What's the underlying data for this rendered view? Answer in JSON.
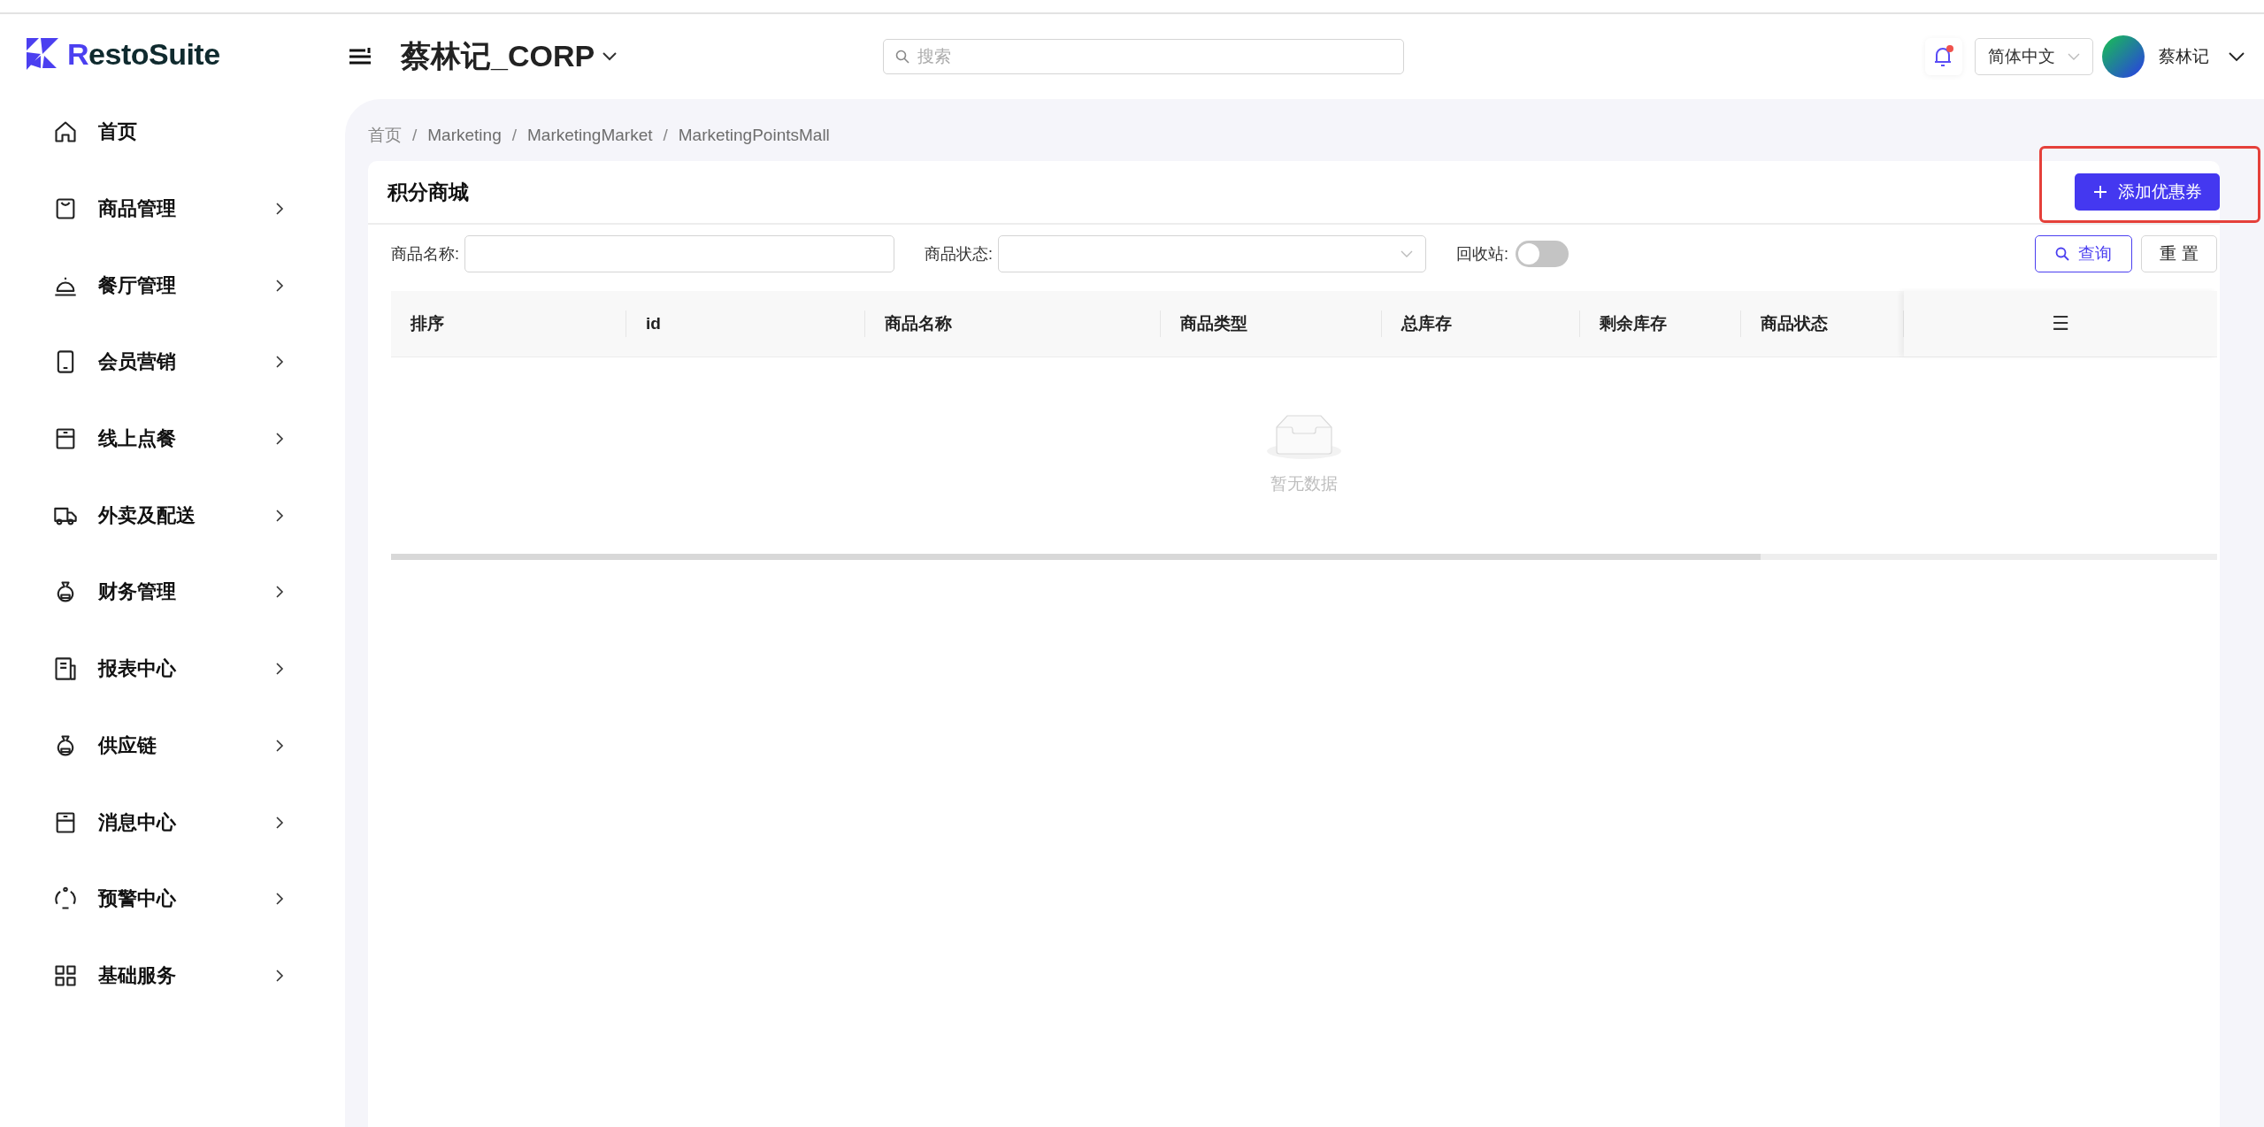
{
  "logo": {
    "accent": "R",
    "rest": "estoSuite"
  },
  "header": {
    "title": "蔡林记_CORP",
    "search": {
      "placeholder": "搜索"
    },
    "notification": {
      "unread": true
    },
    "language": "简体中文",
    "user": "蔡林记"
  },
  "sidebar": {
    "items": [
      {
        "label": "首页",
        "kind": "link"
      },
      {
        "label": "商品管理",
        "kind": "submenu"
      },
      {
        "label": "餐厅管理",
        "kind": "submenu"
      },
      {
        "label": "会员营销",
        "kind": "submenu"
      },
      {
        "label": "线上点餐",
        "kind": "submenu"
      },
      {
        "label": "外卖及配送",
        "kind": "submenu"
      },
      {
        "label": "财务管理",
        "kind": "submenu"
      },
      {
        "label": "报表中心",
        "kind": "submenu"
      },
      {
        "label": "供应链",
        "kind": "submenu"
      },
      {
        "label": "消息中心",
        "kind": "submenu"
      },
      {
        "label": "预警中心",
        "kind": "submenu"
      },
      {
        "label": "基础服务",
        "kind": "submenu"
      }
    ]
  },
  "breadcrumb": {
    "separator": "/",
    "items": [
      "首页",
      "Marketing",
      "MarketingMarket",
      "MarketingPointsMall"
    ]
  },
  "card": {
    "title": "积分商城",
    "add_button": "添加优惠券",
    "filters": {
      "name_label": "商品名称:",
      "status_label": "商品状态:",
      "recycle_label": "回收站:",
      "recycle_on": false,
      "query_button": "查询",
      "reset_button": "重 置"
    },
    "table": {
      "columns": [
        "排序",
        "id",
        "商品名称",
        "商品类型",
        "总库存",
        "剩余库存",
        "商品状态"
      ],
      "menu_icon": "☰",
      "empty_text": "暂无数据"
    }
  }
}
